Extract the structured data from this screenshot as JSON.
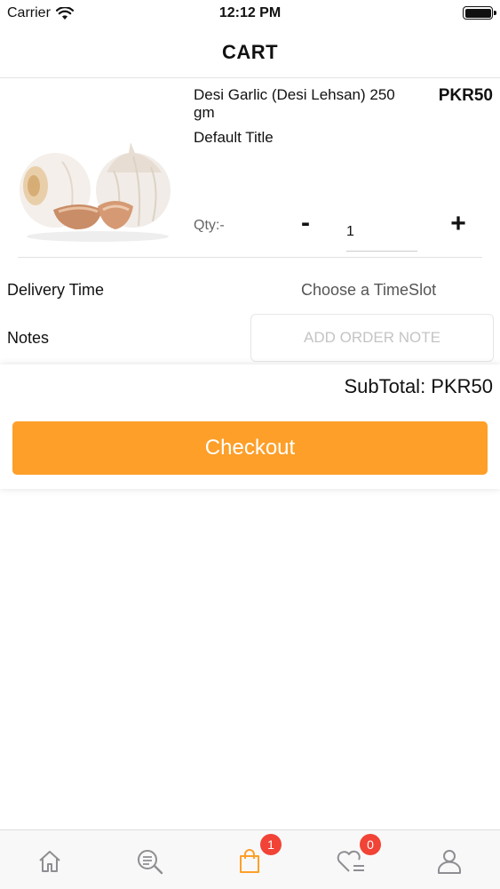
{
  "status_bar": {
    "carrier": "Carrier",
    "time": "12:12 PM"
  },
  "nav": {
    "title": "CART"
  },
  "cart_item": {
    "name": "Desi Garlic (Desi Lehsan) 250 gm",
    "price": "PKR50",
    "variant": "Default Title",
    "qty_label": "Qty:-",
    "qty_value": "1",
    "minus": "-",
    "plus": "+"
  },
  "delivery": {
    "label": "Delivery Time",
    "value": "Choose a TimeSlot"
  },
  "notes": {
    "label": "Notes",
    "placeholder": "ADD ORDER NOTE"
  },
  "summary": {
    "subtotal": "SubTotal: PKR50",
    "checkout_label": "Checkout"
  },
  "tab_bar": {
    "tabs": [
      {
        "icon": "home-icon"
      },
      {
        "icon": "search-icon"
      },
      {
        "icon": "shopping-bag-icon",
        "badge": "1"
      },
      {
        "icon": "wishlist-icon",
        "badge": "0"
      },
      {
        "icon": "profile-icon"
      }
    ]
  },
  "colors": {
    "accent": "#fd9f29",
    "badge": "#f14336"
  }
}
